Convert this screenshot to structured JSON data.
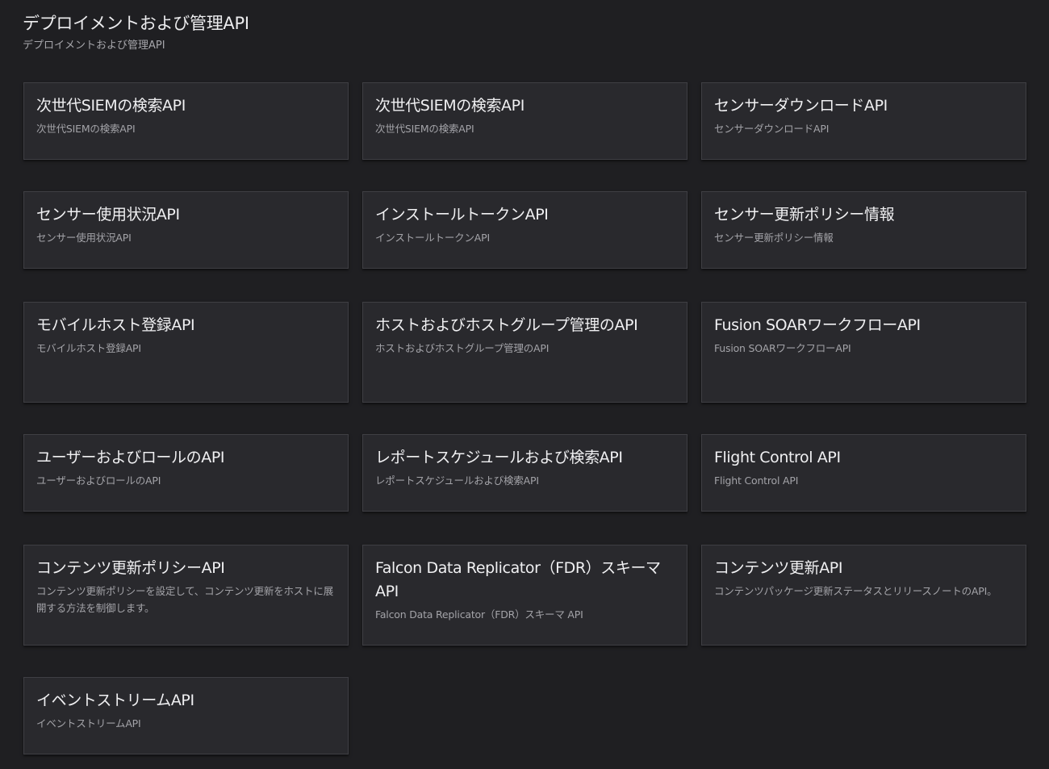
{
  "section": {
    "title": "デプロイメントおよび管理API",
    "subtitle": "デプロイメントおよび管理API"
  },
  "cards": [
    {
      "title": "次世代SIEMの検索API",
      "description": "次世代SIEMの検索API"
    },
    {
      "title": "次世代SIEMの検索API",
      "description": "次世代SIEMの検索API"
    },
    {
      "title": "センサーダウンロードAPI",
      "description": "センサーダウンロードAPI"
    },
    {
      "title": "センサー使用状況API",
      "description": "センサー使用状況API"
    },
    {
      "title": "インストールトークンAPI",
      "description": "インストールトークンAPI"
    },
    {
      "title": "センサー更新ポリシー情報",
      "description": "センサー更新ポリシー情報"
    },
    {
      "title": "モバイルホスト登録API",
      "description": "モバイルホスト登録API"
    },
    {
      "title": "ホストおよびホストグループ管理のAPI",
      "description": "ホストおよびホストグループ管理のAPI"
    },
    {
      "title": "Fusion SOARワークフローAPI",
      "description": "Fusion SOARワークフローAPI"
    },
    {
      "title": "ユーザーおよびロールのAPI",
      "description": "ユーザーおよびロールのAPI"
    },
    {
      "title": "レポートスケジュールおよび検索API",
      "description": "レポートスケジュールおよび検索API"
    },
    {
      "title": "Flight Control API",
      "description": "Flight Control API"
    },
    {
      "title": "コンテンツ更新ポリシーAPI",
      "description": "コンテンツ更新ポリシーを設定して、コンテンツ更新をホストに展開する方法を制御します。"
    },
    {
      "title": "Falcon Data Replicator（FDR）スキーマAPI",
      "description": "Falcon Data Replicator（FDR）スキーマ API"
    },
    {
      "title": "コンテンツ更新API",
      "description": "コンテンツパッケージ更新ステータスとリリースノートのAPI。"
    },
    {
      "title": "イベントストリームAPI",
      "description": "イベントストリームAPI"
    }
  ]
}
